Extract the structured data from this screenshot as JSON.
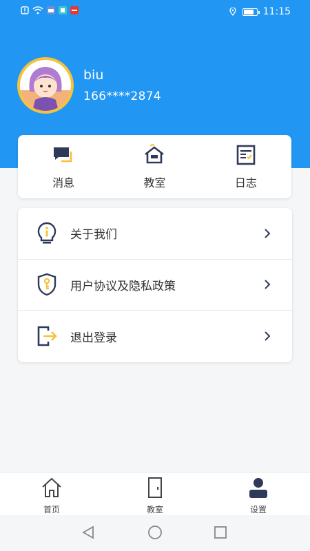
{
  "status_bar": {
    "time": "11:15",
    "left_icons": [
      "alert-icon",
      "wifi-icon",
      "app-icon",
      "app-icon",
      "app-icon"
    ],
    "right_icons": [
      "location-icon",
      "battery-icon"
    ]
  },
  "profile": {
    "name": "biu",
    "phone": "166****2874"
  },
  "quick_actions": [
    {
      "label": "消息",
      "icon": "message-icon"
    },
    {
      "label": "教室",
      "icon": "classroom-icon"
    },
    {
      "label": "日志",
      "icon": "log-icon"
    }
  ],
  "menu": [
    {
      "label": "关于我们",
      "icon": "info-bulb-icon"
    },
    {
      "label": "用户协议及隐私政策",
      "icon": "shield-key-icon"
    },
    {
      "label": "退出登录",
      "icon": "logout-icon"
    }
  ],
  "tabbar": {
    "items": [
      {
        "label": "首页",
        "icon": "home-icon"
      },
      {
        "label": "教室",
        "icon": "door-icon"
      },
      {
        "label": "设置",
        "icon": "user-icon"
      }
    ],
    "active": "设置"
  },
  "colors": {
    "primary": "#2196f3",
    "accent": "#f6c23c",
    "icon_dark": "#2f3a5a"
  }
}
